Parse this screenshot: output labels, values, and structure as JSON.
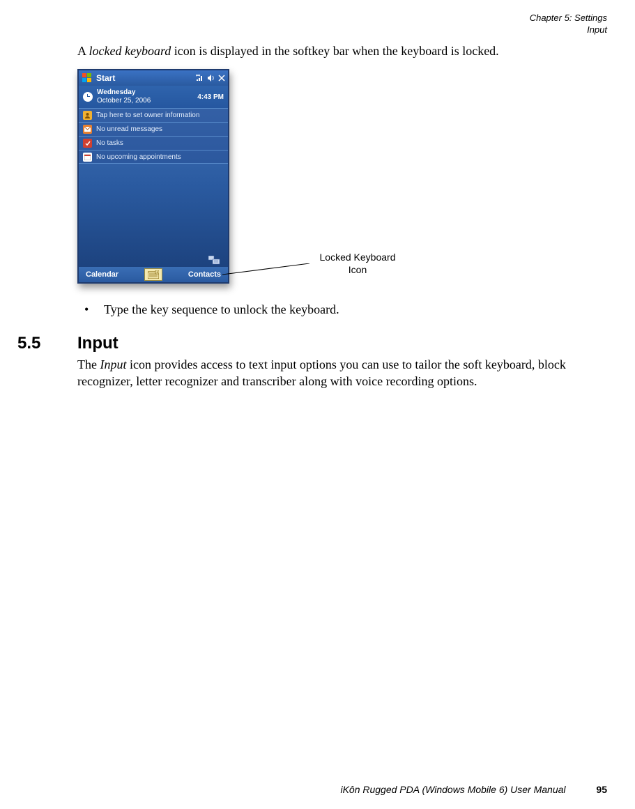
{
  "header": {
    "chapter": "Chapter 5: Settings",
    "section": "Input"
  },
  "intro": {
    "pre": "A ",
    "em": "locked keyboard",
    "post": " icon is displayed in the softkey bar when the keyboard is locked."
  },
  "screenshot": {
    "start_label": "Start",
    "date_day": "Wednesday",
    "date_full": "October 25, 2006",
    "time": "4:43 PM",
    "rows": [
      "Tap here to set owner information",
      "No unread messages",
      "No tasks",
      "No upcoming appointments"
    ],
    "softkey_left": "Calendar",
    "softkey_right": "Contacts"
  },
  "callout": {
    "line1": "Locked Keyboard",
    "line2": "Icon"
  },
  "bullet": "Type the key sequence to unlock the keyboard.",
  "section": {
    "number": "5.5",
    "title": "Input",
    "body_pre": "The ",
    "body_em": "Input",
    "body_post": " icon provides access to text input options you can use to tailor the soft keyboard, block recognizer, letter recognizer and transcriber along with voice recording options."
  },
  "footer": {
    "manual": "iKôn Rugged PDA (Windows Mobile 6) User Manual",
    "page": "95"
  }
}
